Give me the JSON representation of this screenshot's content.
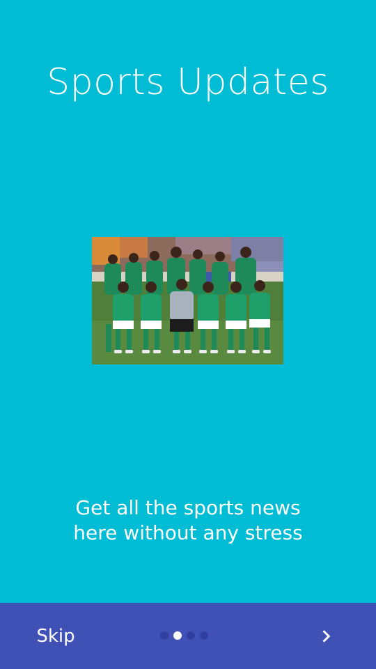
{
  "colors": {
    "background": "#00BCD4",
    "bottom_bar": "#3F51B5",
    "dot_inactive": "#303F9F",
    "dot_active": "#FFFFFF",
    "text": "#FFFFFF"
  },
  "slide": {
    "title": "Sports Updates",
    "image_icon": "team-photo",
    "description_line1": "Get all the sports news",
    "description_line2": "here without any stress"
  },
  "navigation": {
    "skip_label": "Skip",
    "next_icon": "chevron-right-icon",
    "page_count": 4,
    "current_page": 2
  }
}
